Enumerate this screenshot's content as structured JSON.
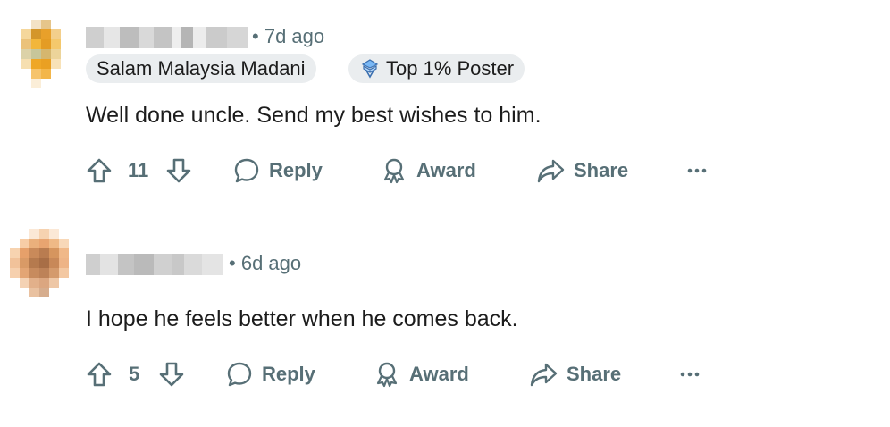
{
  "comments": [
    {
      "time": "7d ago",
      "flairs": [
        {
          "label": "Salam Malaysia Madani",
          "icon": ""
        },
        {
          "label": "Top 1% Poster",
          "icon": "top-poster-icon"
        }
      ],
      "text": "Well done uncle. Send my best wishes to him.",
      "votes": "11",
      "actions": {
        "reply": "Reply",
        "award": "Award",
        "share": "Share"
      },
      "more_icon": "more-icon",
      "avatar_colors": [
        "#e9a52a",
        "#d99a24",
        "#f2b73a",
        "#c9b88a",
        "#f7d59a"
      ]
    },
    {
      "time": "6d ago",
      "flairs": [],
      "text": "I hope he feels better when he comes back.",
      "votes": "5",
      "actions": {
        "reply": "Reply",
        "award": "Award",
        "share": "Share"
      },
      "more_icon": "more-icon",
      "avatar_colors": [
        "#c98a5a",
        "#e5a06a",
        "#b87a4f",
        "#f0c8a5",
        "#d79a6f"
      ]
    }
  ],
  "colors": {
    "meta_text": "#576f76",
    "flair_bg": "#eaedef",
    "body_text": "#1c1c1c"
  }
}
